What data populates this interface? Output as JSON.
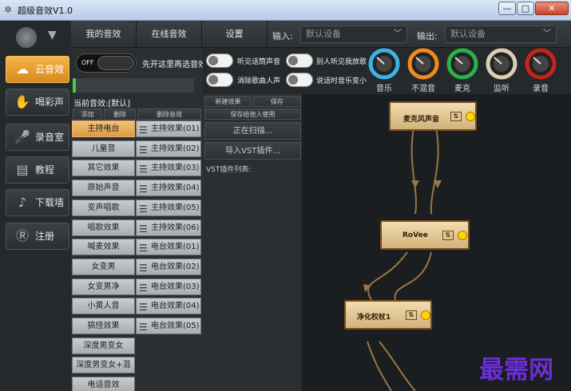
{
  "window": {
    "title": "超级音效V1.0",
    "buttons": {
      "minimize": "—",
      "maximize": "□",
      "close": "✕"
    }
  },
  "top_nav": {
    "tabs": [
      "我的音效",
      "在线音效",
      "设置"
    ],
    "input_label": "输入:",
    "input_value": "默认设备",
    "output_label": "输出:",
    "output_value": "默认设备"
  },
  "sidebar": {
    "items": [
      {
        "label": "云音效",
        "icon": "cloud-icon",
        "active": true
      },
      {
        "label": "喝彩声",
        "icon": "applause-icon",
        "active": false
      },
      {
        "label": "录音室",
        "icon": "microphone-icon",
        "active": false
      },
      {
        "label": "教程",
        "icon": "book-icon",
        "active": false
      },
      {
        "label": "下载墙",
        "icon": "music-note-icon",
        "active": false
      },
      {
        "label": "注册",
        "icon": "register-icon",
        "active": false
      }
    ]
  },
  "switch": {
    "state_label": "OFF",
    "hint": "先开这里再选音效"
  },
  "options": [
    "听见话筒声音",
    "消除歌曲人声",
    "别人听见我放歌",
    "说话时音乐变小"
  ],
  "dials": [
    {
      "label": "音乐",
      "color": "#3ab4e6"
    },
    {
      "label": "不混音",
      "color": "#f08a1c"
    },
    {
      "label": "麦克",
      "color": "#27b34a"
    },
    {
      "label": "监听",
      "color": "#d8d0b0"
    },
    {
      "label": "录音",
      "color": "#c8231a"
    }
  ],
  "current_effect": "当前音效:[默认]",
  "list_actions": [
    "添加",
    "删除",
    "删除音效"
  ],
  "groups": [
    "主持电台",
    "儿童音",
    "其它效果",
    "原始声音",
    "变声唱歌",
    "唱歌效果",
    "喊麦效果",
    "女变男",
    "女变男净",
    "小黄人音",
    "搞怪效果",
    "深度男变女",
    "深度男变女+混响",
    "电话音效"
  ],
  "presets": [
    "主持效果(01)",
    "主持效果(02)",
    "主持效果(03)",
    "主持效果(04)",
    "主持效果(05)",
    "主持效果(06)",
    "电台效果(01)",
    "电台效果(02)",
    "电台效果(03)",
    "电台效果(04)",
    "电台效果(05)"
  ],
  "vst_panel": {
    "new_effect": "新建效果",
    "save": "保存",
    "save_for_others": "保存给他人使用",
    "scanning": "正在扫描...",
    "import": "导入VST插件...",
    "list_label": "VST插件列表:"
  },
  "nodes": [
    {
      "label": "麦克风声音",
      "eq": "⇅"
    },
    {
      "label": "RoVee",
      "eq": "⇅"
    },
    {
      "label": "净化权杖1",
      "eq": "⇅"
    }
  ],
  "watermark": "最需网",
  "accent": "#f0a63a"
}
